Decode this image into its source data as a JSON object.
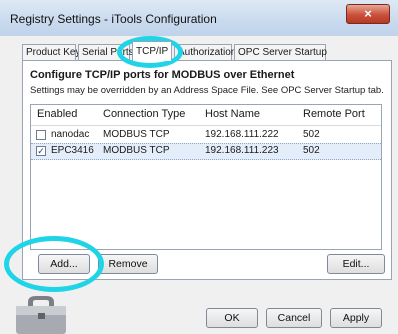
{
  "window": {
    "title": "Registry Settings - iTools Configuration"
  },
  "titlebar": {
    "close_glyph": "×"
  },
  "tabs": [
    {
      "label": "Product Key"
    },
    {
      "label": "Serial Ports"
    },
    {
      "label": "TCP/IP"
    },
    {
      "label": "Authorization"
    },
    {
      "label": "OPC Server Startup"
    }
  ],
  "panel": {
    "heading": "Configure TCP/IP ports for MODBUS over Ethernet",
    "note": "Settings may be overridden by an Address Space File.  See OPC Server Startup tab."
  },
  "table": {
    "columns": [
      "Enabled",
      "Connection Type",
      "Host Name",
      "Remote Port"
    ],
    "rows": [
      {
        "checked": false,
        "check_glyph": "",
        "name": "nanodac",
        "type": "MODBUS TCP",
        "host": "192.168.111.222",
        "port": "502"
      },
      {
        "checked": true,
        "check_glyph": "✓",
        "name": "EPC3416",
        "type": "MODBUS TCP",
        "host": "192.168.111.223",
        "port": "502"
      }
    ]
  },
  "buttons": {
    "add": "Add...",
    "remove": "Remove",
    "edit": "Edit...",
    "ok": "OK",
    "cancel": "Cancel",
    "apply": "Apply"
  },
  "colors": {
    "highlight_annotation": "#20d4e8",
    "titlebar": "#c9daee",
    "close_button": "#c9513a"
  }
}
